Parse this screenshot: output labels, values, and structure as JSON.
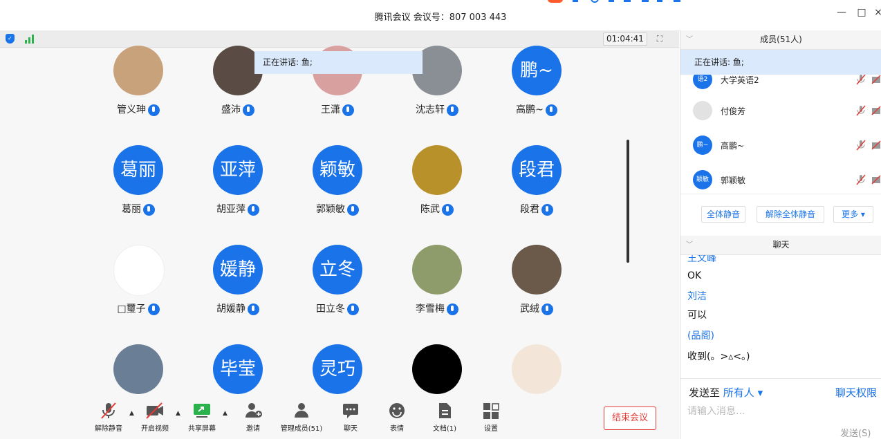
{
  "window": {
    "title": "腾讯会议 会议号：807 003 443",
    "minimize": "—",
    "maximize": "□",
    "close": "×"
  },
  "gallery": {
    "timer": "01:04:41",
    "speaking": "正在讲话: 鱼;",
    "participants": [
      {
        "name": "管义珅",
        "avatar_text": "",
        "avatar_color": "#c8a27a"
      },
      {
        "name": "盛沛",
        "avatar_text": "",
        "avatar_color": "#5a4b45"
      },
      {
        "name": "王潇",
        "avatar_text": "",
        "avatar_color": "#d9a0a0"
      },
      {
        "name": "沈志轩",
        "avatar_text": "",
        "avatar_color": "#8a8f95"
      },
      {
        "name": "高鹏~",
        "avatar_text": "鹏~",
        "avatar_color": "#1a73e8"
      },
      {
        "name": "葛丽",
        "avatar_text": "葛丽",
        "avatar_color": "#1a73e8"
      },
      {
        "name": "胡亚萍",
        "avatar_text": "亚萍",
        "avatar_color": "#1a73e8"
      },
      {
        "name": "郭颖敏",
        "avatar_text": "颖敏",
        "avatar_color": "#1a73e8"
      },
      {
        "name": "陈武",
        "avatar_text": "",
        "avatar_color": "#b8912a"
      },
      {
        "name": "段君",
        "avatar_text": "段君",
        "avatar_color": "#1a73e8"
      },
      {
        "name": "□璽子",
        "avatar_text": "",
        "avatar_color": "#ffffff"
      },
      {
        "name": "胡媛静",
        "avatar_text": "媛静",
        "avatar_color": "#1a73e8"
      },
      {
        "name": "田立冬",
        "avatar_text": "立冬",
        "avatar_color": "#1a73e8"
      },
      {
        "name": "李雪梅",
        "avatar_text": "",
        "avatar_color": "#8e9b6a"
      },
      {
        "name": "武绒",
        "avatar_text": "",
        "avatar_color": "#6b5a4a"
      },
      {
        "name": "",
        "avatar_text": "",
        "avatar_color": "#6a7f96"
      },
      {
        "name": "",
        "avatar_text": "毕莹",
        "avatar_color": "#1a73e8"
      },
      {
        "name": "",
        "avatar_text": "灵巧",
        "avatar_color": "#1a73e8"
      },
      {
        "name": "",
        "avatar_text": "",
        "avatar_color": "#000000"
      },
      {
        "name": "",
        "avatar_text": "",
        "avatar_color": "#f3e6d8"
      }
    ]
  },
  "toolbar": {
    "unmute": "解除静音",
    "video": "开启视频",
    "share": "共享屏幕",
    "invite": "邀请",
    "manage": "管理成员(51)",
    "chat": "聊天",
    "emoji": "表情",
    "docs": "文档(1)",
    "settings": "设置",
    "end": "结束会议"
  },
  "members": {
    "header": "成员(51人)",
    "speaking": "正在讲话: 鱼;",
    "rows": [
      {
        "avatar": "语2",
        "name": "大学英语2"
      },
      {
        "avatar": "",
        "name": "付俊芳"
      },
      {
        "avatar": "鹏~",
        "name": "高鹏~"
      },
      {
        "avatar": "颖敏",
        "name": "郭颖敏"
      }
    ],
    "mute_all": "全体静音",
    "unmute_all": "解除全体静音",
    "more": "更多 ▾"
  },
  "chat": {
    "header": "聊天",
    "messages": [
      {
        "text": "王文峰",
        "kind": "sender"
      },
      {
        "text": "OK",
        "kind": "msg"
      },
      {
        "text": "刘洁",
        "kind": "sender"
      },
      {
        "text": "可以",
        "kind": "msg"
      },
      {
        "text": "(品阁)",
        "kind": "sender"
      },
      {
        "text": "收到(。>▵<。)",
        "kind": "msg"
      }
    ],
    "send_to_label": "发送至",
    "send_to_value": "所有人 ▾",
    "permissions": "聊天权限",
    "input_placeholder": "请输入消息...",
    "send": "发送(S)"
  }
}
